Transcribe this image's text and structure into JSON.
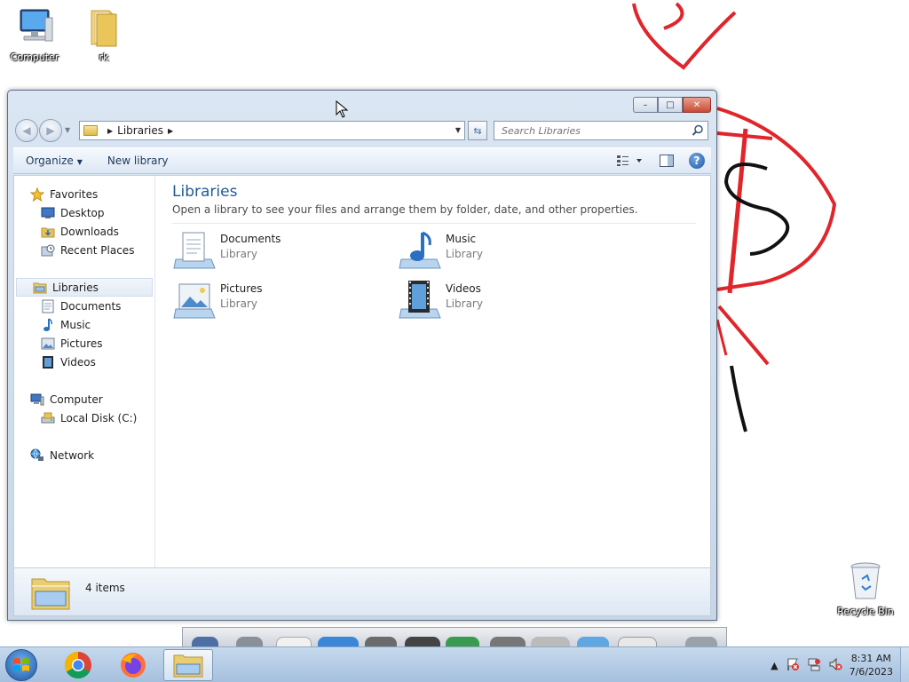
{
  "desktop": {
    "icons": [
      {
        "label": "Computer",
        "icon": "computer-icon"
      },
      {
        "label": "rk",
        "icon": "folder-icon"
      },
      {
        "label": "Recycle Bin",
        "icon": "recycle-bin-icon"
      }
    ]
  },
  "window": {
    "title": "",
    "controls": {
      "minimize": "–",
      "maximize": "□",
      "close": "✕"
    },
    "address": {
      "crumb": "Libraries"
    },
    "search": {
      "placeholder": "Search Libraries"
    },
    "toolbar": {
      "organize": "Organize",
      "new_library": "New library"
    },
    "nav": {
      "favorites": "Favorites",
      "desktop": "Desktop",
      "downloads": "Downloads",
      "recent_places": "Recent Places",
      "libraries": "Libraries",
      "documents": "Documents",
      "music": "Music",
      "pictures": "Pictures",
      "videos": "Videos",
      "computer": "Computer",
      "local_disk": "Local Disk (C:)",
      "network": "Network"
    },
    "main": {
      "heading": "Libraries",
      "subheading": "Open a library to see your files and arrange them by folder, date, and other properties.",
      "libraries": [
        {
          "name": "Documents",
          "type": "Library"
        },
        {
          "name": "Music",
          "type": "Library"
        },
        {
          "name": "Pictures",
          "type": "Library"
        },
        {
          "name": "Videos",
          "type": "Library"
        }
      ]
    },
    "details": {
      "count": "4 items"
    }
  },
  "taskbar": {
    "clock_time": "8:31 AM",
    "clock_date": "7/6/2023",
    "tray_arrow": "▲"
  },
  "colors": {
    "accent": "#1e5a94",
    "close_red": "#c94a34",
    "scribble_red": "#e0252b"
  }
}
